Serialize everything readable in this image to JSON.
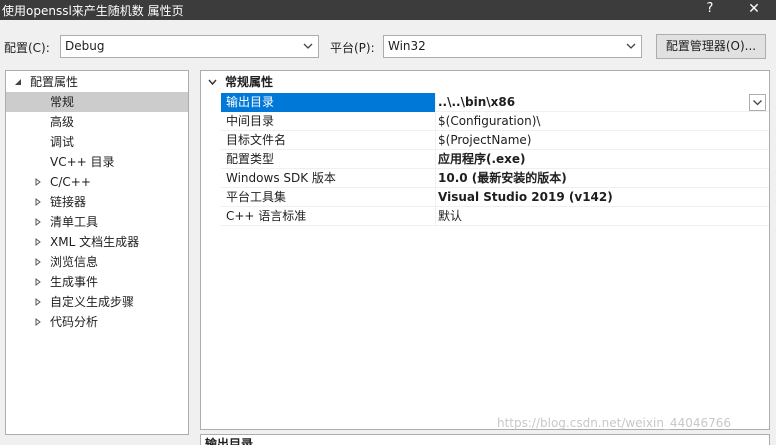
{
  "window": {
    "title": "使用openssl来产生随机数 属性页",
    "help_glyph": "?",
    "close_glyph": "✕"
  },
  "toolbar": {
    "config_label": "配置(C):",
    "config_value": "Debug",
    "platform_label": "平台(P):",
    "platform_value": "Win32",
    "config_manager_label": "配置管理器(O)..."
  },
  "tree": {
    "root": "配置属性",
    "items": [
      {
        "label": "常规"
      },
      {
        "label": "高级"
      },
      {
        "label": "调试"
      },
      {
        "label": "VC++ 目录"
      },
      {
        "label": "C/C++"
      },
      {
        "label": "链接器"
      },
      {
        "label": "清单工具"
      },
      {
        "label": "XML 文档生成器"
      },
      {
        "label": "浏览信息"
      },
      {
        "label": "生成事件"
      },
      {
        "label": "自定义生成步骤"
      },
      {
        "label": "代码分析"
      }
    ]
  },
  "grid": {
    "category": "常规属性",
    "rows": [
      {
        "name": "输出目录",
        "value": "..\\..\\bin\\x86"
      },
      {
        "name": "中间目录",
        "value": "$(Configuration)\\"
      },
      {
        "name": "目标文件名",
        "value": "$(ProjectName)"
      },
      {
        "name": "配置类型",
        "value": "应用程序(.exe)"
      },
      {
        "name": "Windows SDK 版本",
        "value": "10.0 (最新安装的版本)"
      },
      {
        "name": "平台工具集",
        "value": "Visual Studio 2019 (v142)"
      },
      {
        "name": "C++ 语言标准",
        "value": "默认"
      }
    ]
  },
  "description": {
    "title": "输出目录"
  },
  "watermark": "https://blog.csdn.net/weixin_44046766"
}
